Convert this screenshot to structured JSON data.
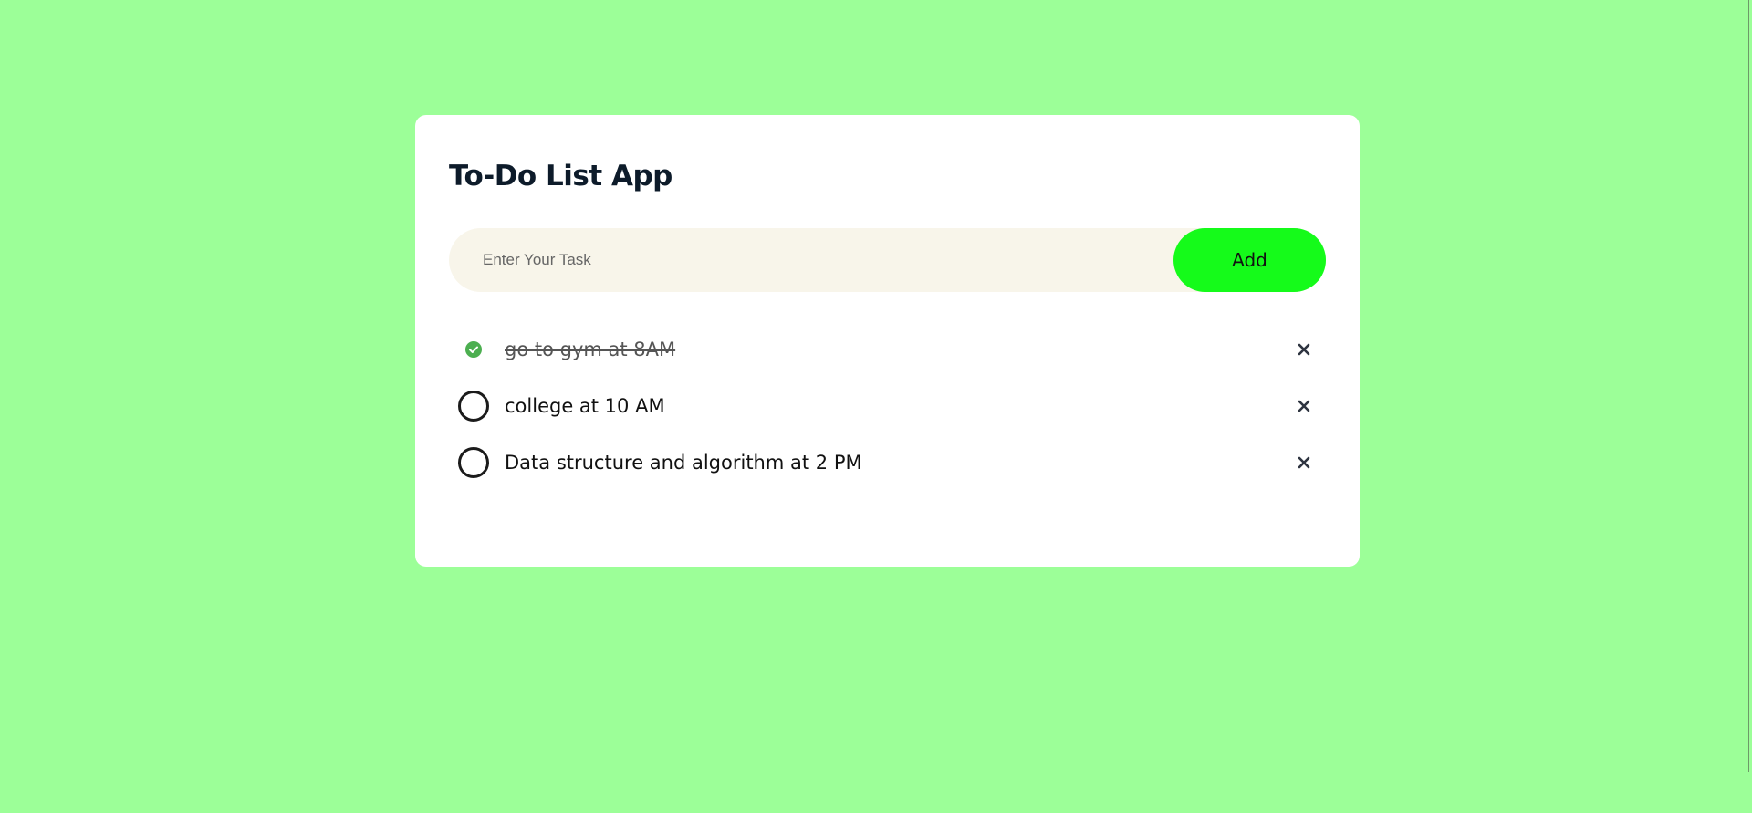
{
  "app": {
    "title": "To-Do List App"
  },
  "input": {
    "placeholder": "Enter Your Task",
    "value": ""
  },
  "add_button": {
    "label": "Add"
  },
  "tasks": [
    {
      "text": "go to gym at 8AM",
      "completed": true
    },
    {
      "text": "college at 10 AM",
      "completed": false
    },
    {
      "text": "Data structure and algorithm at 2 PM",
      "completed": false
    }
  ],
  "colors": {
    "background": "#9cff98",
    "card": "#ffffff",
    "input_bg": "#f8f5ea",
    "accent": "#15fb1a",
    "done_check": "#4caf50",
    "title": "#0d1b2a"
  },
  "icons": {
    "completed": "check-circle-icon",
    "uncompleted": "circle-icon",
    "delete": "close-icon"
  }
}
